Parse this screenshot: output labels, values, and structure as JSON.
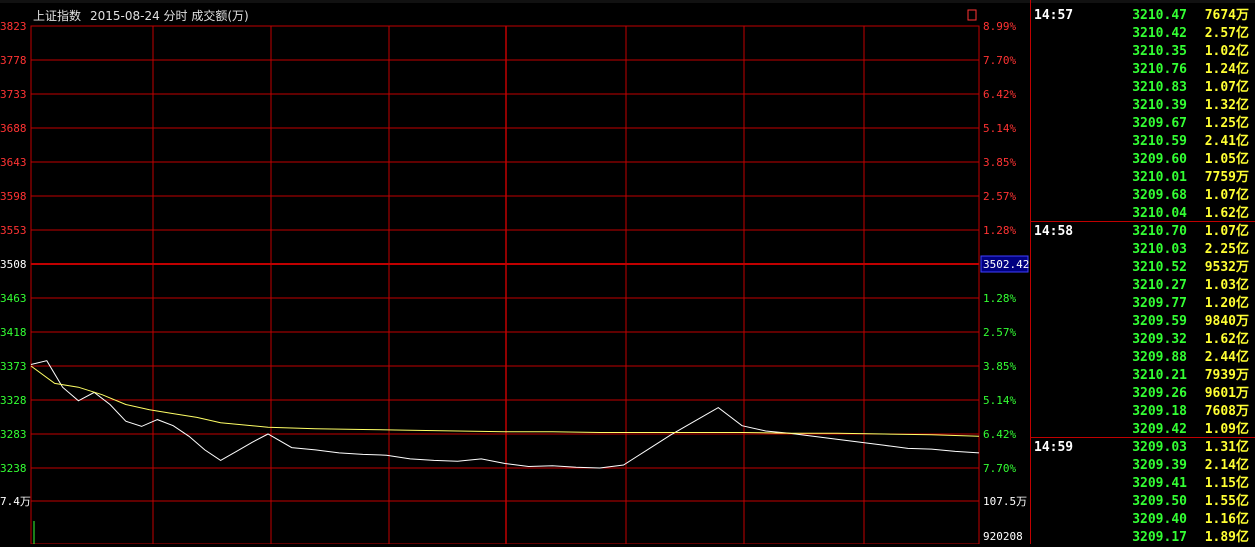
{
  "header": {
    "title": "上证指数",
    "date_info": "2015-08-24 分时 成交额(万)"
  },
  "colors": {
    "grid": "#c00000",
    "price_line": "#ffffff",
    "avg_line": "#ffff66",
    "axis_red": "#ff3333",
    "axis_green": "#33ff33",
    "price": "#33ff33",
    "volume": "#ffff33"
  },
  "chart_data": {
    "type": "line",
    "y_left_ticks": [
      "3823",
      "3778",
      "3733",
      "3688",
      "3643",
      "3598",
      "3553",
      "3508",
      "3463",
      "3418",
      "3373",
      "3328",
      "3283",
      "3238"
    ],
    "y_right_ticks": [
      "8.99%",
      "7.70%",
      "6.42%",
      "5.14%",
      "3.85%",
      "2.57%",
      "1.28%",
      "1.28%",
      "2.57%",
      "3.85%",
      "5.14%",
      "6.42%",
      "7.70%"
    ],
    "prev_close_label": "3502.42",
    "bottom_left_label": "7.4万",
    "bottom_right_labels": [
      "107.5万",
      "920208"
    ],
    "ylim": [
      3238,
      3823
    ],
    "xlim": [
      0,
      240
    ],
    "series": [
      {
        "x": [
          0,
          4,
          8,
          12,
          16,
          20,
          24,
          28,
          32,
          36,
          40,
          44,
          48,
          52,
          56,
          60,
          66,
          72,
          78,
          84,
          90,
          96,
          102,
          108,
          114,
          120,
          126,
          132,
          138,
          144,
          150,
          156,
          162,
          168,
          174,
          180,
          186,
          192,
          198,
          204,
          210,
          216,
          222,
          228,
          234,
          240
        ],
        "values": [
          3375,
          3380,
          3345,
          3327,
          3338,
          3322,
          3300,
          3293,
          3302,
          3294,
          3280,
          3262,
          3248,
          3260,
          3272,
          3283,
          3265,
          3262,
          3258,
          3256,
          3255,
          3250,
          3248,
          3247,
          3250,
          3244,
          3240,
          3241,
          3239,
          3238,
          3242,
          3262,
          3282,
          3300,
          3318,
          3294,
          3287,
          3284,
          3280,
          3276,
          3272,
          3268,
          3264,
          3263,
          3260,
          3258
        ]
      },
      {
        "x": [
          0,
          6,
          12,
          18,
          24,
          30,
          36,
          42,
          48,
          60,
          72,
          84,
          96,
          108,
          120,
          132,
          144,
          156,
          168,
          180,
          192,
          204,
          216,
          228,
          240
        ],
        "values": [
          3373,
          3350,
          3345,
          3335,
          3322,
          3315,
          3310,
          3305,
          3298,
          3292,
          3290,
          3289,
          3288,
          3287,
          3286,
          3286,
          3285,
          3285,
          3285,
          3285,
          3284,
          3284,
          3283,
          3282,
          3280
        ]
      }
    ]
  },
  "ticks": [
    {
      "time": "14:57",
      "price": "3210.47",
      "vol": "7674万"
    },
    {
      "time": "",
      "price": "3210.42",
      "vol": "2.57亿"
    },
    {
      "time": "",
      "price": "3210.35",
      "vol": "1.02亿"
    },
    {
      "time": "",
      "price": "3210.76",
      "vol": "1.24亿"
    },
    {
      "time": "",
      "price": "3210.83",
      "vol": "1.07亿"
    },
    {
      "time": "",
      "price": "3210.39",
      "vol": "1.32亿"
    },
    {
      "time": "",
      "price": "3209.67",
      "vol": "1.25亿"
    },
    {
      "time": "",
      "price": "3210.59",
      "vol": "2.41亿"
    },
    {
      "time": "",
      "price": "3209.60",
      "vol": "1.05亿"
    },
    {
      "time": "",
      "price": "3210.01",
      "vol": "7759万"
    },
    {
      "time": "",
      "price": "3209.68",
      "vol": "1.07亿"
    },
    {
      "time": "",
      "price": "3210.04",
      "vol": "1.62亿"
    },
    {
      "time": "14:58",
      "price": "3210.70",
      "vol": "1.07亿"
    },
    {
      "time": "",
      "price": "3210.03",
      "vol": "2.25亿"
    },
    {
      "time": "",
      "price": "3210.52",
      "vol": "9532万"
    },
    {
      "time": "",
      "price": "3210.27",
      "vol": "1.03亿"
    },
    {
      "time": "",
      "price": "3209.77",
      "vol": "1.20亿"
    },
    {
      "time": "",
      "price": "3209.59",
      "vol": "9840万"
    },
    {
      "time": "",
      "price": "3209.32",
      "vol": "1.62亿"
    },
    {
      "time": "",
      "price": "3209.88",
      "vol": "2.44亿"
    },
    {
      "time": "",
      "price": "3210.21",
      "vol": "7939万"
    },
    {
      "time": "",
      "price": "3209.26",
      "vol": "9601万"
    },
    {
      "time": "",
      "price": "3209.18",
      "vol": "7608万"
    },
    {
      "time": "",
      "price": "3209.42",
      "vol": "1.09亿"
    },
    {
      "time": "14:59",
      "price": "3209.03",
      "vol": "1.31亿"
    },
    {
      "time": "",
      "price": "3209.39",
      "vol": "2.14亿"
    },
    {
      "time": "",
      "price": "3209.41",
      "vol": "1.15亿"
    },
    {
      "time": "",
      "price": "3209.50",
      "vol": "1.55亿"
    },
    {
      "time": "",
      "price": "3209.40",
      "vol": "1.16亿"
    },
    {
      "time": "",
      "price": "3209.17",
      "vol": "1.89亿"
    }
  ]
}
